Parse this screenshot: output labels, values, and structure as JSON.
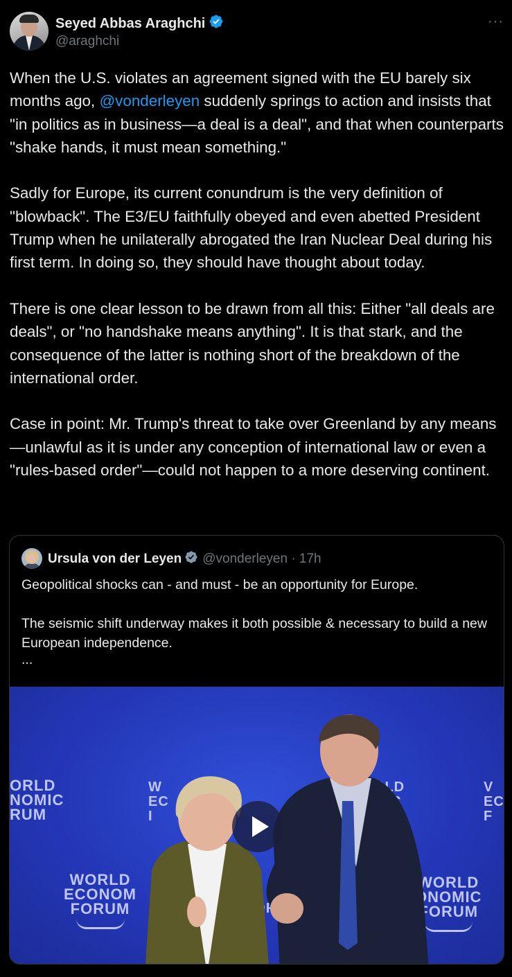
{
  "author": {
    "name": "Seyed Abbas Araghchi",
    "handle": "@araghchi",
    "more_label": "···"
  },
  "tweet": {
    "p1_before": "When the U.S. violates an agreement signed with the EU barely six months ago, ",
    "p1_mention": "@vonderleyen",
    "p1_after": " suddenly springs to action and insists that \"in politics as in business—a deal is a deal\", and that when counterparts \"shake hands, it must mean something.\"",
    "p2": "Sadly for Europe, its current conundrum is the very definition of \"blowback\". The E3/EU faithfully obeyed and even abetted President Trump when he unilaterally abrogated the Iran Nuclear Deal during his first term. In doing so, they should have thought about today.",
    "p3": "There is one clear lesson to be drawn from all this: Either \"all deals are deals\", or \"no handshake means anything\". It is that stark, and the consequence of the latter is nothing short of the breakdown of the international order.",
    "p4": "Case in point: Mr. Trump's threat to take over Greenland by any means—unlawful as it is under any conception of international law or even a \"rules-based order\"—could not happen to a more deserving continent."
  },
  "quoted": {
    "name": "Ursula von der Leyen",
    "meta": "@vonderleyen · 17h",
    "p1": "Geopolitical shocks can - and must - be an opportunity for Europe.",
    "p2": "The seismic shift underway makes it both possible & necessary to build a new European independence.",
    "ellipsis": "...",
    "video": {
      "logos": [
        {
          "l1": "ORLD",
          "l2": "NOMIC",
          "l3": "RUM"
        },
        {
          "l1": "W",
          "l2": "EC",
          "l3": "I"
        },
        {
          "l1": "RLD",
          "l2": "MIC",
          "l3": ""
        },
        {
          "l1": "V",
          "l2": "EC",
          "l3": "F"
        },
        {
          "l1": "WORLD",
          "l2": "ECONOM",
          "l3": "FORUM"
        },
        {
          "l1": "",
          "l2": "",
          "l3": "FORU"
        },
        {
          "l1": "WORLD",
          "l2": "ONOMIC",
          "l3": "FORUM"
        }
      ]
    }
  },
  "colors": {
    "background": "#000000",
    "text": "#e7e9ea",
    "secondary": "#71767b",
    "link": "#1d9bf0",
    "verified": "#1d9bf0",
    "border": "#2f3336",
    "video_bg": "#2437b8"
  },
  "icons": {
    "verified": "verified-badge-icon",
    "play": "play-icon",
    "more": "more-icon"
  }
}
